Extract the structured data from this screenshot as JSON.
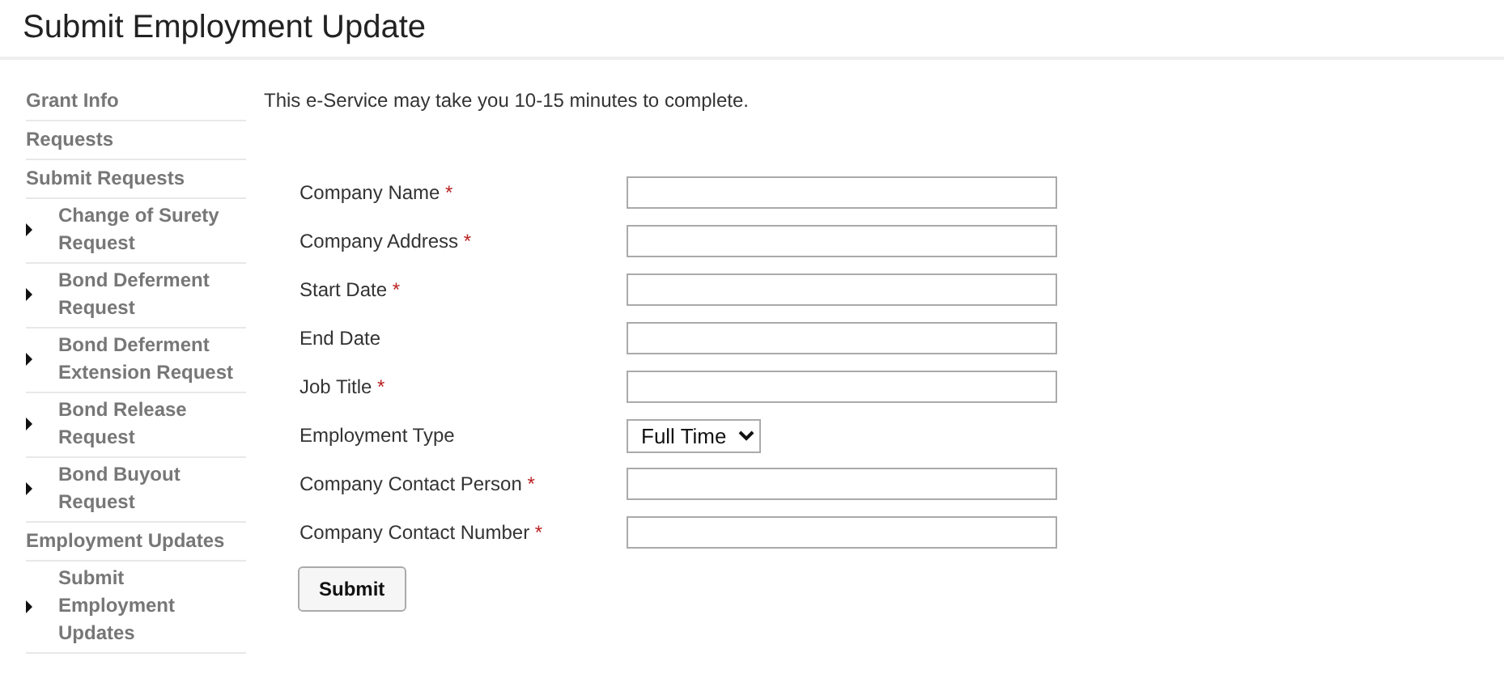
{
  "page_title": "Submit Employment Update",
  "sidebar": {
    "items": [
      {
        "kind": "header",
        "label": "Grant Info"
      },
      {
        "kind": "header",
        "label": "Requests"
      },
      {
        "kind": "header",
        "label": "Submit Requests"
      },
      {
        "kind": "sub",
        "label": "Change of Surety Request"
      },
      {
        "kind": "sub",
        "label": "Bond Deferment Request"
      },
      {
        "kind": "sub",
        "label": "Bond Deferment Extension Request"
      },
      {
        "kind": "sub",
        "label": "Bond Release Request"
      },
      {
        "kind": "sub",
        "label": "Bond Buyout Request"
      },
      {
        "kind": "header",
        "label": "Employment Updates"
      },
      {
        "kind": "sub",
        "label": "Submit Employment Updates"
      }
    ]
  },
  "intro": "This e-Service may take you 10-15 minutes to complete.",
  "form": {
    "fields": [
      {
        "kind": "text",
        "label": "Company Name",
        "required_mark": "*"
      },
      {
        "kind": "text",
        "label": "Company Address",
        "required_mark": "*"
      },
      {
        "kind": "text",
        "label": "Start Date",
        "required_mark": "*"
      },
      {
        "kind": "text",
        "label": "End Date"
      },
      {
        "kind": "text",
        "label": "Job Title",
        "required_mark": "*"
      },
      {
        "kind": "select",
        "label": "Employment Type",
        "value": "Full Time"
      },
      {
        "kind": "text",
        "label": "Company Contact Person",
        "required_mark": "*"
      },
      {
        "kind": "text",
        "label": "Company Contact Number",
        "required_mark": "*"
      }
    ],
    "submit": "Submit"
  }
}
